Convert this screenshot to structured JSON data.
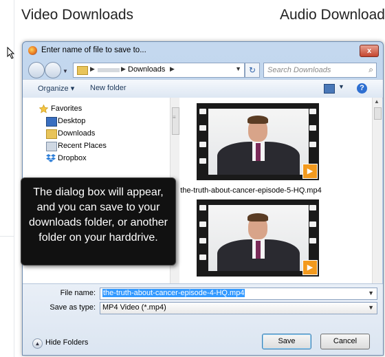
{
  "background": {
    "left_heading": "Video Downloads",
    "right_heading": "Audio Download"
  },
  "dialog": {
    "title": "Enter name of file to save to...",
    "close_label": "x",
    "address": {
      "crumb": "Downloads"
    },
    "search_placeholder": "Search Downloads",
    "toolbar": {
      "organize": "Organize ▾",
      "new_folder": "New folder"
    },
    "nav": {
      "favorites": "Favorites",
      "items": [
        "Desktop",
        "Downloads",
        "Recent Places",
        "Dropbox"
      ]
    },
    "files": [
      {
        "name": "the-truth-about-cancer-episode-5-HQ.mp4"
      },
      {
        "name": ""
      }
    ],
    "file_name_label": "File name:",
    "file_name_value": "the-truth-about-cancer-episode-4-HQ.mp4",
    "save_as_type_label": "Save as type:",
    "save_as_type_value": "MP4 Video (*.mp4)",
    "hide_folders": "Hide Folders",
    "save_button": "Save",
    "cancel_button": "Cancel"
  },
  "callout": {
    "text": "The dialog box will appear, and you can save to your downloads folder, or another folder on your harddrive."
  },
  "colors": {
    "accent": "#3399ff",
    "play_badge": "#f39a1e",
    "callout_bg": "#111111"
  }
}
